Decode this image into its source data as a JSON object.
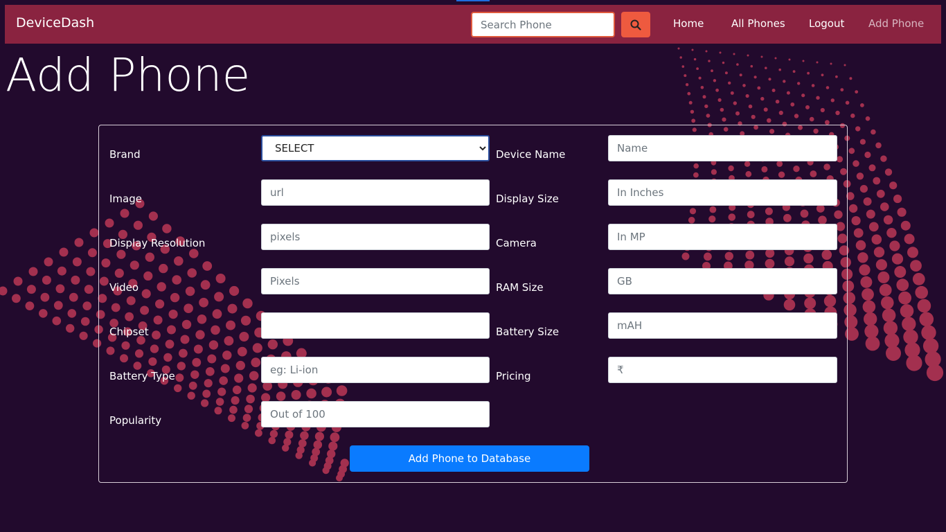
{
  "navbar": {
    "brand": "DeviceDash",
    "search_placeholder": "Search Phone",
    "search_icon": "search-icon",
    "links": [
      "Home",
      "All Phones",
      "Logout",
      "Add Phone"
    ]
  },
  "page": {
    "title": "Add Phone"
  },
  "form": {
    "brand_label": "Brand",
    "brand_selected": "SELECT",
    "device_name_label": "Device Name",
    "device_name_placeholder": "Name",
    "image_label": "Image",
    "image_placeholder": "url",
    "display_size_label": "Display Size",
    "display_size_placeholder": "In Inches",
    "display_resolution_label": "Display Resolution",
    "display_resolution_placeholder": "pixels",
    "camera_label": "Camera",
    "camera_placeholder": "In MP",
    "video_label": "Video",
    "video_placeholder": "Pixels",
    "ram_label": "RAM Size",
    "ram_placeholder": "GB",
    "chipset_label": "Chipset",
    "chipset_placeholder": "",
    "battery_size_label": "Battery Size",
    "battery_size_placeholder": "mAH",
    "battery_type_label": "Battery Type",
    "battery_type_placeholder": "eg: Li-ion",
    "pricing_label": "Pricing",
    "pricing_placeholder": "₹",
    "popularity_label": "Popularity",
    "popularity_placeholder": "Out of 100",
    "submit_label": "Add Phone to Database"
  },
  "colors": {
    "background": "#220a2d",
    "navbar": "#8a2340",
    "search_button": "#ee5a3f",
    "primary_button": "#0a7bff",
    "dots": "#a3304f"
  }
}
